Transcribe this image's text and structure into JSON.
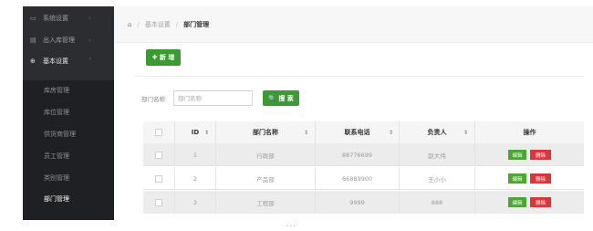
{
  "sidebar": {
    "items": [
      {
        "icon": "monitor-icon",
        "glyph": "▭",
        "label": "系统设置",
        "arrow": "›"
      },
      {
        "icon": "inout-icon",
        "glyph": "▤",
        "label": "出入库管理",
        "arrow": "›"
      },
      {
        "icon": "globe-icon",
        "glyph": "⊕",
        "label": "基本设置",
        "arrow": "˅"
      }
    ],
    "submenu": [
      "库房管理",
      "库位管理",
      "供货商管理",
      "员工管理",
      "类别管理",
      "部门管理"
    ],
    "active_submenu": "部门管理"
  },
  "breadcrumb": {
    "home_glyph": "⌂",
    "sep": "/",
    "parent": "基本设置",
    "current": "部门管理"
  },
  "toolbar": {
    "add_label": "✚ 新 增"
  },
  "search": {
    "label": "部门名称",
    "placeholder": "部门名称",
    "button_label": "🔍 搜 索"
  },
  "table": {
    "columns": [
      "",
      "ID",
      "部门名称",
      "联系电话",
      "负责人",
      "操作"
    ],
    "sort_glyph": "⇕",
    "rows": [
      {
        "id": "1",
        "name": "行政部",
        "phone": "88776699",
        "owner": "赵大伟",
        "edit": "编辑",
        "delete": "删除"
      },
      {
        "id": "2",
        "name": "产品部",
        "phone": "66889900",
        "owner": "王小小",
        "edit": "编辑",
        "delete": "删除"
      },
      {
        "id": "3",
        "name": "工程部",
        "phone": "9999",
        "owner": "888",
        "edit": "编辑",
        "delete": "删除"
      }
    ]
  },
  "footer": {
    "text": "· · ·"
  },
  "colors": {
    "sidebar_bg": "#2b2d30",
    "submenu_bg": "#1f2023",
    "primary_green": "#3c9a33",
    "danger_red": "#d9373c"
  }
}
